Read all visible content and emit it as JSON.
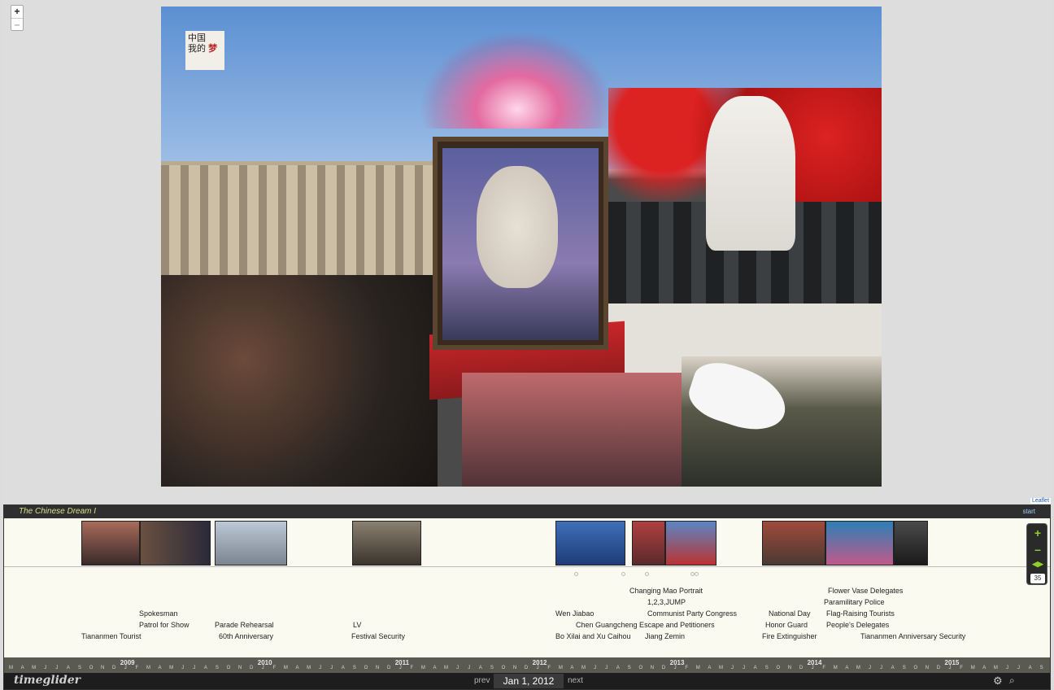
{
  "map": {
    "zoom_in_label": "+",
    "zoom_out_label": "–",
    "attribution": "Leaflet",
    "sticker_line1": "中国",
    "sticker_line2": "我的",
    "sticker_mark": "梦"
  },
  "timeline": {
    "title": "The Chinese Dream I",
    "start_label": "start",
    "logo": "timeglider",
    "prev_label": "prev",
    "current_date": "Jan 1, 2012",
    "next_label": "next",
    "zoom_plus": "+",
    "zoom_minus": "–",
    "zoom_arrows": "◀▶",
    "zoom_level": "35",
    "events": [
      {
        "label": "Tiananmen Tourist"
      },
      {
        "label": "Spokesman"
      },
      {
        "label": "Patrol for Show"
      },
      {
        "label": "Parade Rehearsal"
      },
      {
        "label": "60th Anniversary"
      },
      {
        "label": "LV"
      },
      {
        "label": "Festival Security"
      },
      {
        "label": "Changing Mao Portrait"
      },
      {
        "label": "1,2,3,JUMP"
      },
      {
        "label": "Wen Jiabao"
      },
      {
        "label": "Communist Party Congress"
      },
      {
        "label": "Chen Guangcheng Escape and Petitioners"
      },
      {
        "label": "Bo Xilai and Xu Caihou"
      },
      {
        "label": "Jiang Zemin"
      },
      {
        "label": "National Day"
      },
      {
        "label": "Honor Guard"
      },
      {
        "label": "Fire Extinguisher"
      },
      {
        "label": "Flower Vase Delegates"
      },
      {
        "label": "Paramilitary Police"
      },
      {
        "label": "Flag-Raising Tourists"
      },
      {
        "label": "People's Delegates"
      },
      {
        "label": "Tiananmen Anniversary Security"
      }
    ],
    "years": [
      "2009",
      "2010",
      "2011",
      "2012",
      "2013",
      "2014",
      "2015"
    ],
    "months": [
      "M",
      "A",
      "M",
      "J",
      "J",
      "A",
      "S",
      "O",
      "N",
      "D",
      "J",
      "F",
      "M",
      "A",
      "M",
      "J",
      "J",
      "A",
      "S",
      "O",
      "N",
      "D",
      "J",
      "F",
      "M",
      "A",
      "M",
      "J",
      "J",
      "A",
      "S",
      "O",
      "N",
      "D",
      "J",
      "F",
      "M",
      "A",
      "M",
      "J",
      "J",
      "A",
      "S",
      "O",
      "N",
      "D",
      "J",
      "F",
      "M",
      "A",
      "M",
      "J",
      "J",
      "A",
      "S",
      "O",
      "N",
      "D",
      "J",
      "F",
      "M",
      "A",
      "M",
      "J",
      "J",
      "A",
      "S",
      "O",
      "N",
      "D",
      "J",
      "F",
      "M",
      "A",
      "M",
      "J",
      "J",
      "A",
      "S",
      "O",
      "N",
      "D",
      "J",
      "F",
      "M",
      "A",
      "M",
      "J",
      "J",
      "A",
      "S",
      "O",
      "N",
      "D",
      "J",
      "F",
      "M",
      "A"
    ]
  },
  "colors": {
    "header_bg": "#2f2f2f",
    "title_color": "#d8e08a",
    "zoom_accent": "#8ed12a",
    "timeline_bg": "#fbfaf0"
  }
}
